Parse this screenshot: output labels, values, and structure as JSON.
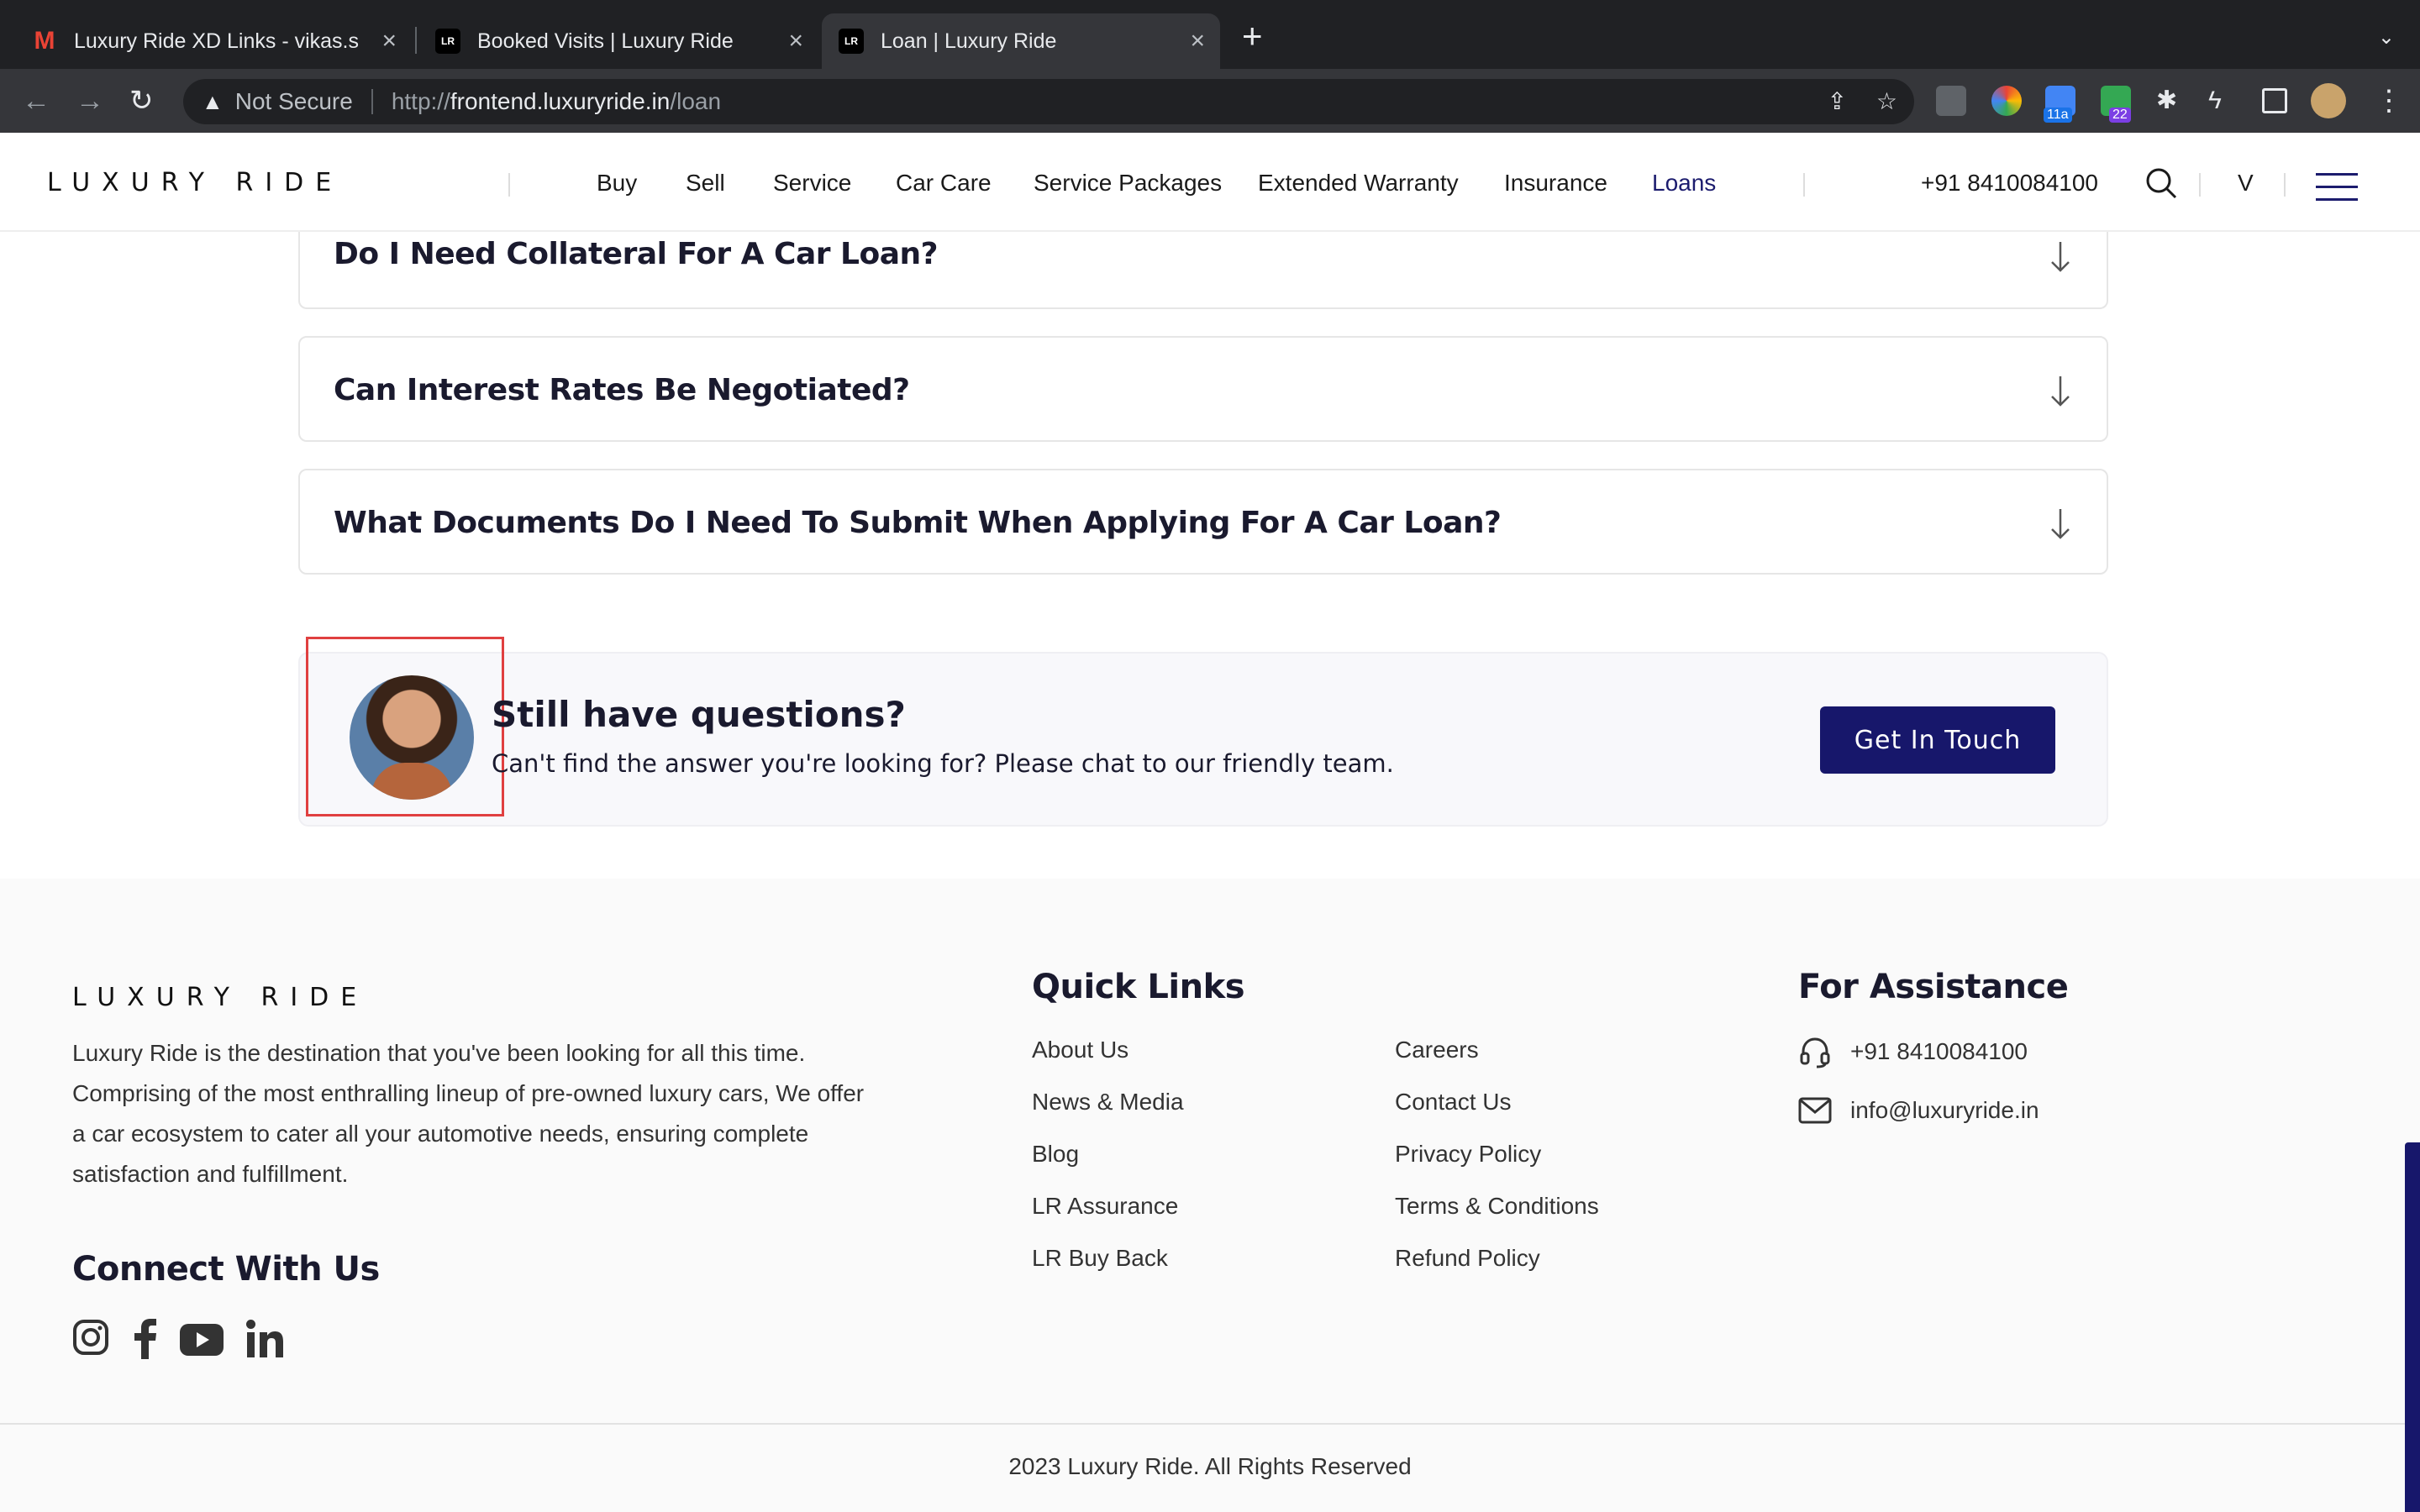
{
  "browser": {
    "tabs": [
      {
        "title": "Luxury Ride XD Links - vikas.s",
        "favicon": "gmail-icon"
      },
      {
        "title": "Booked Visits | Luxury Ride",
        "favicon": "lr-icon"
      },
      {
        "title": "Loan | Luxury Ride",
        "favicon": "lr-icon",
        "active": true
      }
    ],
    "security_label": "Not Secure",
    "url_proto": "http://",
    "url_host": "frontend.luxuryride.in",
    "url_path": "/loan",
    "ext_badges": [
      "11a",
      "22"
    ]
  },
  "header": {
    "logo": "LUXURY RIDE",
    "nav": [
      "Buy",
      "Sell",
      "Service",
      "Car Care",
      "Service Packages",
      "Extended Warranty",
      "Insurance",
      "Loans"
    ],
    "active_nav": "Loans",
    "phone": "+91 8410084100",
    "user_initial": "V"
  },
  "faq": {
    "items": [
      "Do I Need Collateral For A Car Loan?",
      "Can Interest Rates Be Negotiated?",
      "What Documents Do I Need To Submit When Applying For A Car Loan?"
    ]
  },
  "cta": {
    "title": "Still have questions?",
    "subtitle": "Can't find the answer you're looking for? Please chat to our friendly team.",
    "button": "Get In Touch"
  },
  "footer": {
    "logo": "LUXURY RIDE",
    "description": "Luxury Ride is the destination that you've been looking for all this time. Comprising of the most enthralling lineup of pre-owned luxury cars, We offer a car ecosystem to cater all your automotive needs, ensuring complete satisfaction and fulfillment.",
    "connect_heading": "Connect With Us",
    "social": [
      "instagram-icon",
      "facebook-icon",
      "youtube-icon",
      "linkedin-icon"
    ],
    "quick_links_heading": "Quick Links",
    "quick_links_col1": [
      "About Us",
      "News & Media",
      "Blog",
      "LR Assurance",
      "LR Buy Back"
    ],
    "quick_links_col2": [
      "Careers",
      "Contact Us",
      "Privacy Policy",
      "Terms & Conditions",
      "Refund Policy"
    ],
    "assistance_heading": "For Assistance",
    "assist_phone": "+91 8410084100",
    "assist_email": "info@luxuryride.in",
    "copyright": "2023 Luxury Ride. All Rights Reserved"
  }
}
